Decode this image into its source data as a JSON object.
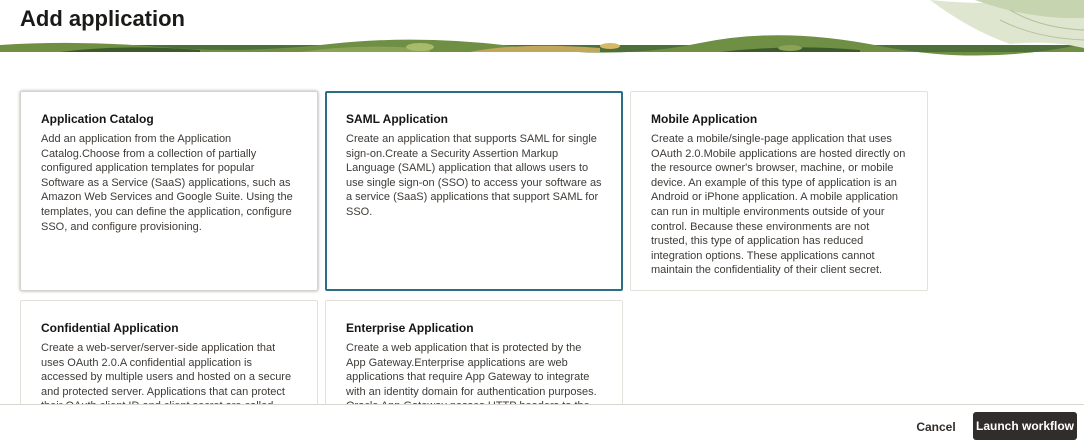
{
  "dialog": {
    "title": "Add application"
  },
  "cards": [
    {
      "title": "Application Catalog",
      "description": "Add an application from the Application Catalog.Choose from a collection of partially configured application templates for popular Software as a Service (SaaS) applications, such as Amazon Web Services and Google Suite. Using the templates, you can define the application, configure SSO, and configure provisioning."
    },
    {
      "title": "SAML Application",
      "description": "Create an application that supports SAML for single sign-on.Create a Security Assertion Markup Language (SAML) application that allows users to use single sign-on (SSO) to access your software as a service (SaaS) applications that support SAML for SSO."
    },
    {
      "title": "Mobile Application",
      "description": "Create a mobile/single-page application that uses OAuth 2.0.Mobile applications are hosted directly on the resource owner's browser, machine, or mobile device. An example of this type of application is an Android or iPhone application. A mobile application can run in multiple environments outside of your control. Because these environments are not trusted, this type of application has reduced integration options. These applications cannot maintain the confidentiality of their client secret."
    },
    {
      "title": "Confidential Application",
      "description": "Create a web-server/server-side application that uses OAuth 2.0.A confidential application is accessed by multiple users and hosted on a secure and protected server. Applications that can protect their OAuth client ID and client secret are called confidential applications."
    },
    {
      "title": "Enterprise Application",
      "description": "Create a web application that is protected by the App Gateway.Enterprise applications are web applications that require App Gateway to integrate with an identity domain for authentication purposes. Oracle App Gateway passes HTTP headers to the applications after"
    }
  ],
  "footer": {
    "cancel_label": "Cancel",
    "launch_label": "Launch workflow"
  },
  "colors": {
    "selected_border": "#2b6f86",
    "primary_button": "#312d2a",
    "header_accent_green": "#5c7f3a"
  },
  "selected_card": "SAML Application"
}
